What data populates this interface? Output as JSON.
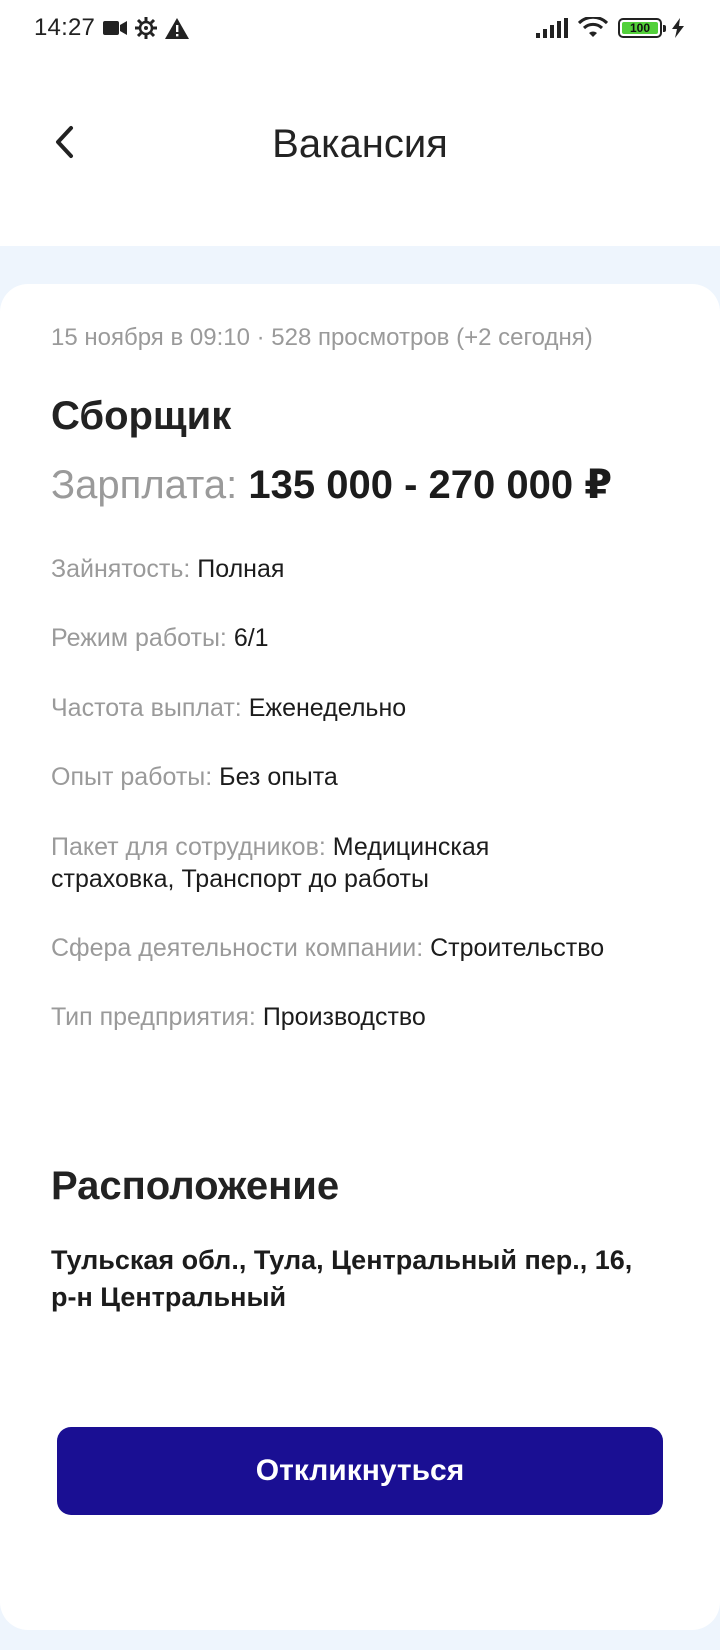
{
  "status_bar": {
    "time": "14:27",
    "icons": [
      "video-camera-icon",
      "settings-gear-icon",
      "warning-icon",
      "signal-icon",
      "wifi-icon",
      "battery-icon",
      "charging-bolt-icon"
    ],
    "battery_level": "100",
    "battery_fraction": 1.0,
    "battery_color": "#52d03a"
  },
  "header": {
    "back_icon": "chevron-left-icon",
    "title": "Вакансия"
  },
  "vacancy": {
    "meta": "15 ноября в 09:10 · 528 просмотров (+2 сегодня)",
    "title": "Сборщик",
    "salary_label": "Зарплата:",
    "salary_value": "135 000 - 270 000 ₽",
    "details": [
      {
        "label": "Зайнятость:",
        "value": "Полная"
      },
      {
        "label": "Режим работы:",
        "value": "6/1"
      },
      {
        "label": "Частота выплат:",
        "value": "Еженедельно"
      },
      {
        "label": "Опыт работы:",
        "value": "Без опыта"
      },
      {
        "label": "Пакет для сотрудников:",
        "value": "Медицинская страховка, Транспорт до работы"
      },
      {
        "label": "Сфера деятельности компании:",
        "value": "Строительство"
      },
      {
        "label": "Тип предприятия:",
        "value": "Производство"
      }
    ]
  },
  "location": {
    "title": "Расположение",
    "address": "Тульская обл., Тула, Центральный пер., 16, р-н Центральный"
  },
  "actions": {
    "apply_label": "Откликнуться",
    "apply_color": "#1a0f93"
  }
}
